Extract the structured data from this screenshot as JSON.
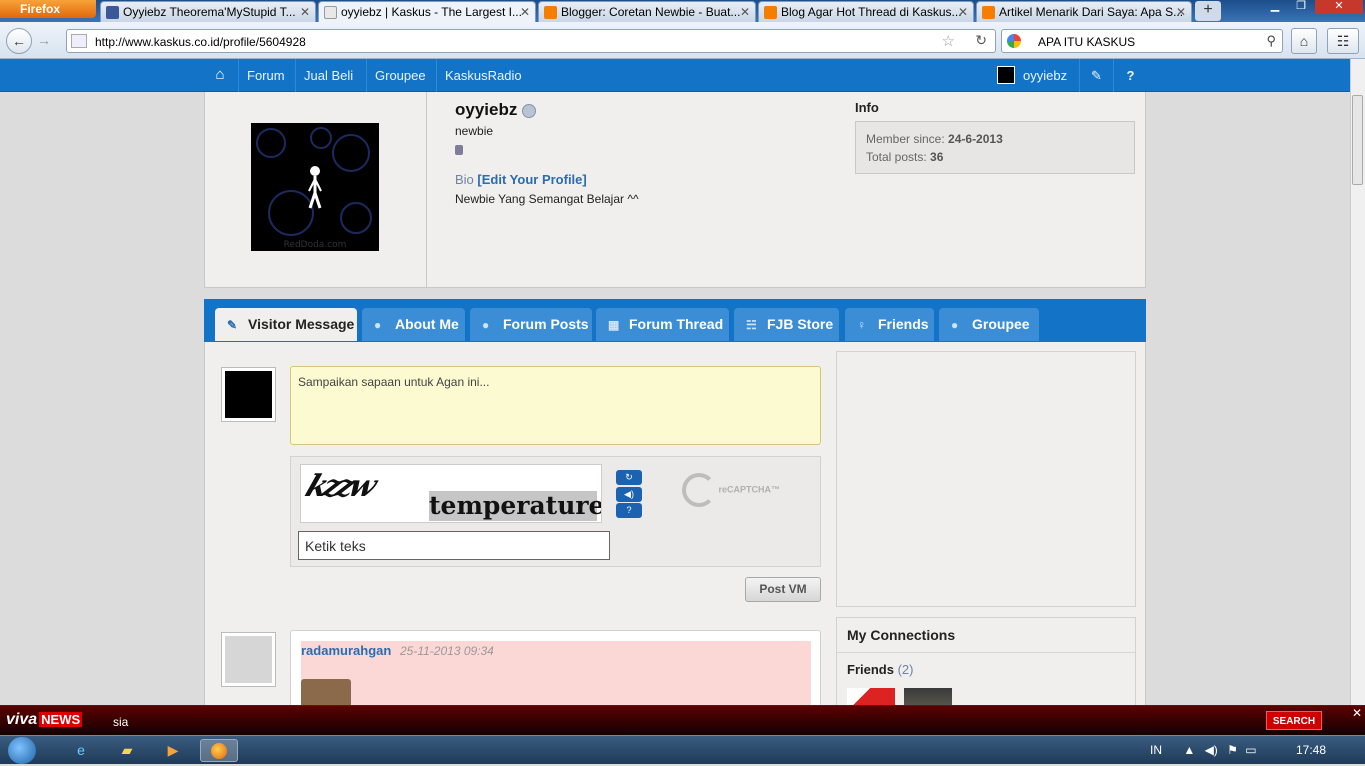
{
  "browser": {
    "app_button": "Firefox",
    "tabs": [
      {
        "title": "Oyyiebz Theorema'MyStupid T...",
        "favicon_color": "#3b5998"
      },
      {
        "title": "oyyiebz | Kaskus - The Largest I...",
        "favicon_color": "#e8e8e8"
      },
      {
        "title": "Blogger: Coretan Newbie - Buat...",
        "favicon_color": "#f57d00"
      },
      {
        "title": "Blog Agar Hot Thread di Kaskus...",
        "favicon_color": "#f57d00"
      },
      {
        "title": "Artikel Menarik Dari Saya: Apa S...",
        "favicon_color": "#f57d00"
      }
    ],
    "new_tab": "+",
    "url": "http://www.kaskus.co.id/profile/5604928",
    "search_query": "APA ITU KASKUS"
  },
  "kaskus_nav": {
    "items": [
      "Forum",
      "Jual Beli",
      "Groupee",
      "KaskusRadio"
    ],
    "username": "oyyiebz"
  },
  "profile": {
    "username": "oyyiebz",
    "rank": "newbie",
    "bio_label": "Bio",
    "bio_edit": "[Edit Your Profile]",
    "bio_text": "Newbie Yang Semangat Belajar ^^",
    "avatar_watermark": "RedDoda.com",
    "info_title": "Info",
    "member_since_label": "Member since:",
    "member_since": "24-6-2013",
    "total_posts_label": "Total posts:",
    "total_posts": "36"
  },
  "profile_tabs": [
    "Visitor Message",
    "About Me",
    "Forum Posts",
    "Forum Thread",
    "FJB Store",
    "Friends",
    "Groupee"
  ],
  "visitor_message": {
    "placeholder": "Sampaikan sapaan untuk Agan ini...",
    "captcha_scribble": "kzzw",
    "captcha_word": "temperature",
    "captcha_placeholder": "Ketik teks",
    "recaptcha_label": "reCAPTCHA™",
    "post_button": "Post VM"
  },
  "connections": {
    "title": "My Connections",
    "friends_label": "Friends",
    "friends_count": "(2)"
  },
  "messages": [
    {
      "user": "radamurahgan",
      "time": "25-11-2013 09:34"
    }
  ],
  "viva_bar": {
    "logo": "viva",
    "logo_news": "NEWS",
    "ticker": "sia",
    "search": "SEARCH"
  },
  "taskbar": {
    "language": "IN",
    "clock": "17:48"
  }
}
